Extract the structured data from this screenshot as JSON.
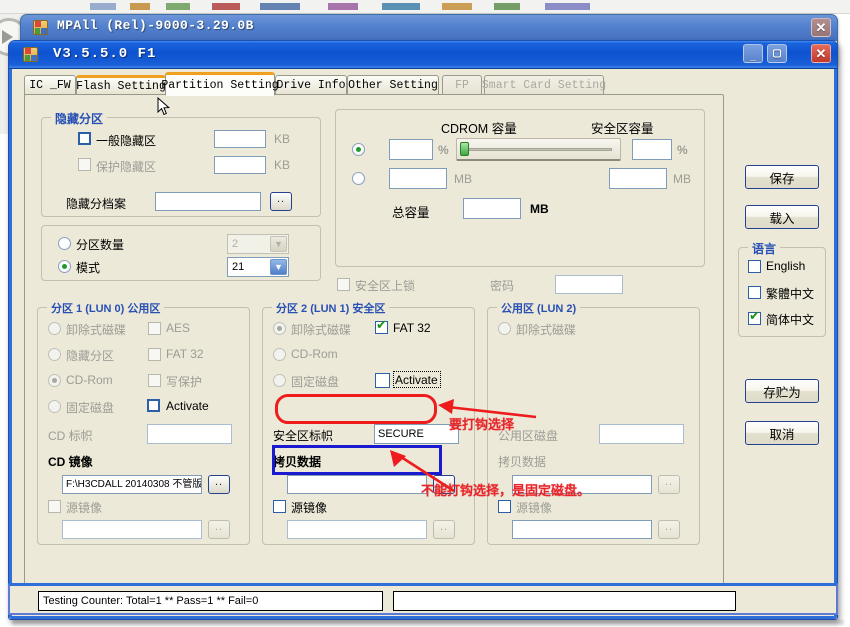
{
  "desktop": {
    "note": ""
  },
  "back_window": {
    "title": "MPAll (Rel)-9000-3.29.0B",
    "close_label": "✕",
    "icon": "app-blocks-icon"
  },
  "main_window": {
    "title": "V3.5.5.0 F1",
    "minimize_label": "_",
    "maximize_label": "▢",
    "close_label": "✕"
  },
  "tabs": [
    {
      "label": "IC _FW",
      "state": "normal"
    },
    {
      "label": "Flash Setting",
      "state": "hot"
    },
    {
      "label": "Partition Setting",
      "state": "active"
    },
    {
      "label": "Drive Info",
      "state": "normal"
    },
    {
      "label": "Other Setting",
      "state": "normal"
    },
    {
      "label": "FP",
      "state": "disabled"
    },
    {
      "label": "Smart Card Setting",
      "state": "disabled"
    }
  ],
  "hidden_partition": {
    "title": "隐藏分区",
    "general_hidden_label": "一般隐藏区",
    "general_hidden_value": "",
    "general_hidden_unit": "KB",
    "protect_hidden_label": "保护隐藏区",
    "protect_hidden_value": "",
    "protect_hidden_unit": "KB",
    "file_label": "隐藏分档案",
    "file_value": "",
    "browse_label": ".."
  },
  "partition_mode": {
    "count_label": "分区数量",
    "count_value": "2",
    "mode_label": "模式",
    "mode_value": "21"
  },
  "capacity": {
    "cdrom_title": "CDROM 容量",
    "secure_title": "安全区容量",
    "cdrom_percent_value": "",
    "percent_unit": "%",
    "secure_percent_value": "",
    "secure_percent_unit": "%",
    "cdrom_mb_value": "",
    "cdrom_mb_unit": "MB",
    "secure_mb_value": "",
    "secure_mb_unit": "MB",
    "total_label": "总容量",
    "total_value": "",
    "total_unit": "MB",
    "slider_position_percent": 0
  },
  "secure_lock": {
    "lock_label": "安全区上锁",
    "password_label": "密码",
    "password_value": ""
  },
  "lun0": {
    "title": "分区 1 (LUN 0) 公用区",
    "removable_label": "卸除式磁碟",
    "hidden_label": "隐藏分区",
    "cdrom_label": "CD-Rom",
    "fixed_label": "固定磁盘",
    "aes_label": "AES",
    "fat32_label": "FAT 32",
    "writeprotect_label": "写保护",
    "activate_label": "Activate",
    "cd_flag_label": "CD 标帜",
    "cd_flag_value": "",
    "cd_image_label": "CD 镜像",
    "cd_image_value": "F:\\H3CDALL 20140308 不管版",
    "source_image_label": "源镜像",
    "source_image_value": "",
    "browse_label": ".."
  },
  "lun1": {
    "title": "分区 2 (LUN 1) 安全区",
    "removable_label": "卸除式磁碟",
    "cdrom_label": "CD-Rom",
    "fixed_label": "固定磁盘",
    "fat32_label": "FAT 32",
    "activate_label": "Activate",
    "secure_flag_label": "安全区标帜",
    "secure_flag_value": "SECURE",
    "copy_data_label": "拷贝数据",
    "copy_data_value": "",
    "source_image_label": "源镜像",
    "source_image_value": "",
    "browse_label": ".."
  },
  "lun2": {
    "title": "公用区 (LUN 2)",
    "removable_label": "卸除式磁碟",
    "public_disk_label": "公用区磁盘",
    "public_disk_value": "",
    "copy_data_label": "拷贝数据",
    "copy_data_value": "",
    "source_image_label": "源镜像",
    "source_image_value": "",
    "browse_label": ".."
  },
  "sidebar": {
    "save_label": "保存",
    "load_label": "载入",
    "language_title": "语言",
    "languages": [
      {
        "label": "English",
        "checked": false
      },
      {
        "label": "繁體中文",
        "checked": false
      },
      {
        "label": "简体中文",
        "checked": true
      }
    ],
    "save_as_label": "存贮为",
    "cancel_label": "取消"
  },
  "annotations": [
    {
      "text": "要打钩选择",
      "color": "#e8262a"
    },
    {
      "text": "不能打钩选择，是固定磁盘。",
      "color": "#e8262a"
    }
  ],
  "status": {
    "counter_text": "Testing Counter: Total=1 ** Pass=1 ** Fail=0",
    "second_field_text": ""
  },
  "colors": {
    "highlight_red": "#ee1c1c",
    "highlight_blue": "#1a1ad0",
    "group_title_blue": "#2850b4",
    "window_blue": "#0d52d0",
    "face": "#ece9d8"
  }
}
